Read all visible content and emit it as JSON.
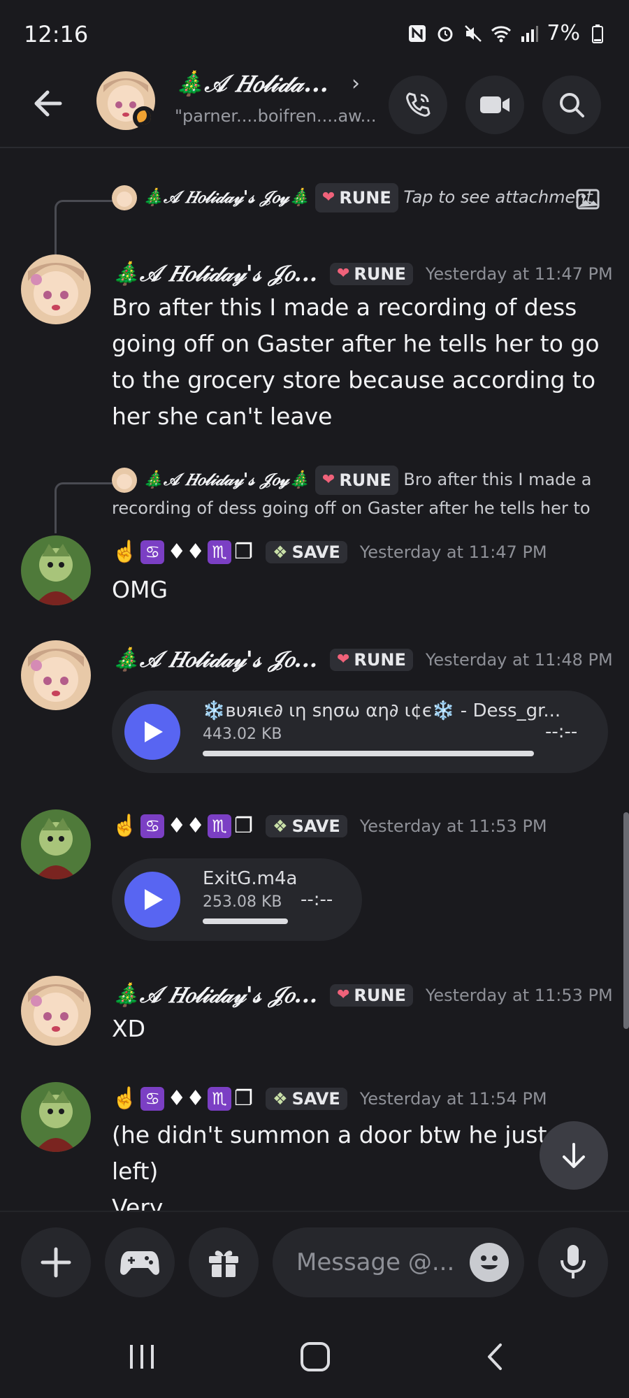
{
  "status_bar": {
    "time": "12:16",
    "battery": "7%"
  },
  "header": {
    "title": "🎄𝒜 𝐻𝑜𝓁𝒾𝒹𝒶...",
    "subtitle": "\"parner....boifren....aw...",
    "icons": [
      "back-arrow-icon",
      "voice-call-icon",
      "video-call-icon",
      "search-icon"
    ]
  },
  "messages": [
    {
      "reply": {
        "author": "🎄𝒜 𝐻𝑜𝓁𝒾𝒹𝒶𝓎'𝓈 𝒥𝑜𝓎🎄",
        "tag": "RUNE",
        "text": "Tap to see attachment"
      },
      "author": "🎄𝒜 𝐻𝑜𝓁𝒾𝒹𝒶𝓎'𝓈 𝒥𝑜...",
      "tag": "RUNE",
      "time": "Yesterday at 11:47 PM",
      "text": "Bro after this I made a recording of dess going off on Gaster after he tells her to go to the grocery store because according to her she can't leave"
    },
    {
      "reply": {
        "author": "🎄𝒜 𝐻𝑜𝓁𝒾𝒹𝒶𝓎'𝓈 𝒥𝑜𝓎🎄",
        "tag": "RUNE",
        "text": "Bro after this I made a recording of dess going off on Gaster after he tells her to"
      },
      "author": "☝️♋♦♦♏❐",
      "tag": "SAVE",
      "time": "Yesterday at 11:47 PM",
      "text": "OMG"
    },
    {
      "author": "🎄𝒜 𝐻𝑜𝓁𝒾𝒹𝒶𝓎'𝓈 𝒥𝑜...",
      "tag": "RUNE",
      "time": "Yesterday at 11:48 PM",
      "audio": {
        "title": "❄️вυяιє∂ ιη ѕησω αη∂ ι¢є❄️ - Dess_gr...",
        "size": "443.02 KB",
        "duration": "--:--"
      }
    },
    {
      "author": "☝️♋♦♦♏❐",
      "tag": "SAVE",
      "time": "Yesterday at 11:53 PM",
      "audio": {
        "title": "ExitG.m4a",
        "size": "253.08 KB",
        "duration": "--:--"
      }
    },
    {
      "author": "🎄𝒜 𝐻𝑜𝓁𝒾𝒹𝒶𝓎'𝓈 𝒥𝑜...",
      "tag": "RUNE",
      "time": "Yesterday at 11:53 PM",
      "text": "XD"
    },
    {
      "author": "☝️♋♦♦♏❐",
      "tag": "SAVE",
      "time": "Yesterday at 11:54 PM",
      "text": "(he didn't summon a door btw he just fu     g left)",
      "text2": "Very"
    }
  ],
  "composer": {
    "placeholder": "Message @..."
  },
  "colors": {
    "background": "#1a1a1e",
    "accent": "#5865f2",
    "muted": "#8e9097"
  }
}
